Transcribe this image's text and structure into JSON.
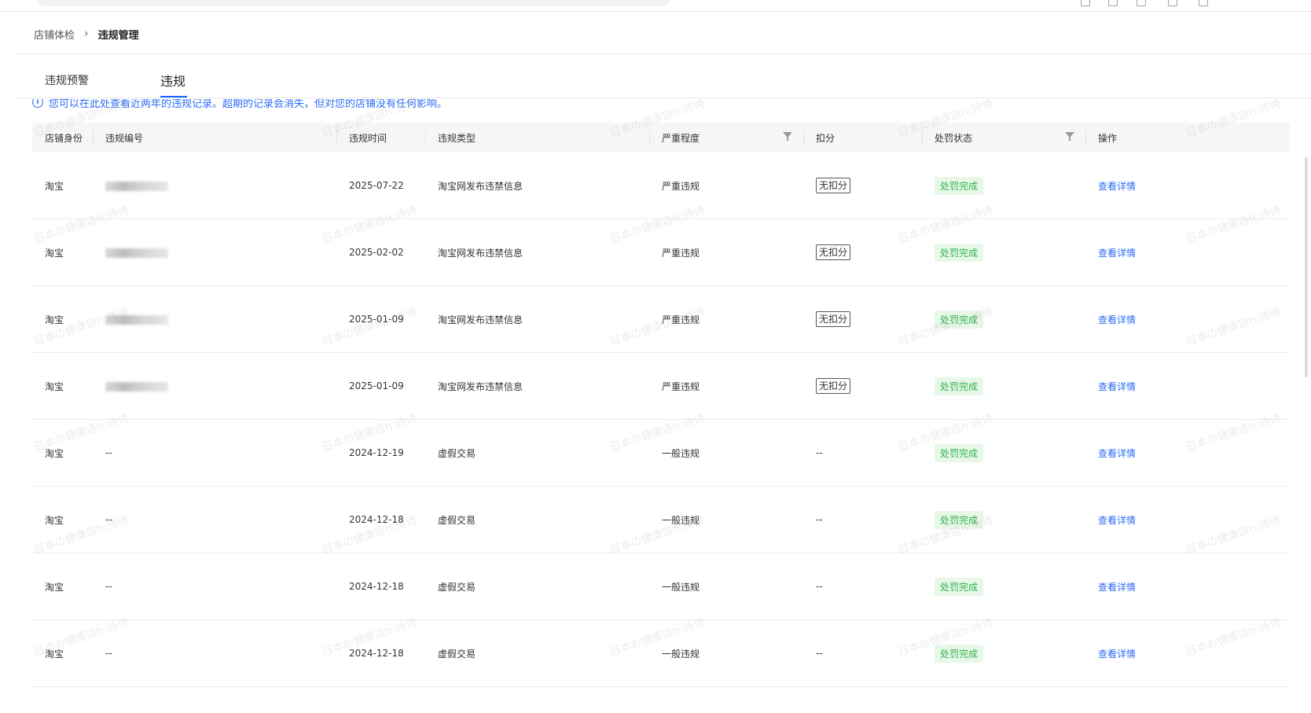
{
  "breadcrumb": {
    "parent": "店铺体检",
    "separator": "›",
    "current": "违规管理"
  },
  "tabs": [
    {
      "label": "违规预警"
    },
    {
      "label": "违规"
    }
  ],
  "notice": {
    "text": "您可以在此处查看近两年的违规记录。超期的记录会消失，但对您的店铺没有任何影响。"
  },
  "table": {
    "headers": {
      "identity": "店铺身份",
      "code": "违规编号",
      "time": "违规时间",
      "type": "违规类型",
      "severity": "严重程度",
      "score": "扣分",
      "status": "处罚状态",
      "action": "操作"
    },
    "rows": [
      {
        "identity": "淘宝",
        "code": "",
        "time": "2025-07-22",
        "type": "淘宝网发布违禁信息",
        "severity": "严重违规",
        "score": "无扣分",
        "status": "处罚完成",
        "action": "查看详情"
      },
      {
        "identity": "淘宝",
        "code": "",
        "time": "2025-02-02",
        "type": "淘宝网发布违禁信息",
        "severity": "严重违规",
        "score": "无扣分",
        "status": "处罚完成",
        "action": "查看详情"
      },
      {
        "identity": "淘宝",
        "code": "",
        "time": "2025-01-09",
        "type": "淘宝网发布违禁信息",
        "severity": "严重违规",
        "score": "无扣分",
        "status": "处罚完成",
        "action": "查看详情"
      },
      {
        "identity": "淘宝",
        "code": "",
        "time": "2025-01-09",
        "type": "淘宝网发布违禁信息",
        "severity": "严重违规",
        "score": "无扣分",
        "status": "处罚完成",
        "action": "查看详情"
      },
      {
        "identity": "淘宝",
        "code": "--",
        "time": "2024-12-19",
        "type": "虚假交易",
        "severity": "一般违规",
        "score": "--",
        "status": "处罚完成",
        "action": "查看详情"
      },
      {
        "identity": "淘宝",
        "code": "--",
        "time": "2024-12-18",
        "type": "虚假交易",
        "severity": "一般违规",
        "score": "--",
        "status": "处罚完成",
        "action": "查看详情"
      },
      {
        "identity": "淘宝",
        "code": "--",
        "time": "2024-12-18",
        "type": "虚假交易",
        "severity": "一般违规",
        "score": "--",
        "status": "处罚完成",
        "action": "查看详情"
      },
      {
        "identity": "淘宝",
        "code": "--",
        "time": "2024-12-18",
        "type": "虚假交易",
        "severity": "一般违规",
        "score": "--",
        "status": "处罚完成",
        "action": "查看详情"
      }
    ]
  },
  "watermark": {
    "text": "日本の健康店h:诗诗"
  },
  "colors": {
    "link": "#2b6cf5",
    "status_text": "#2fb24c",
    "status_bg": "#e8f8e8",
    "header_bg": "#f5f6f8",
    "tab_active": "#1a66ff"
  }
}
